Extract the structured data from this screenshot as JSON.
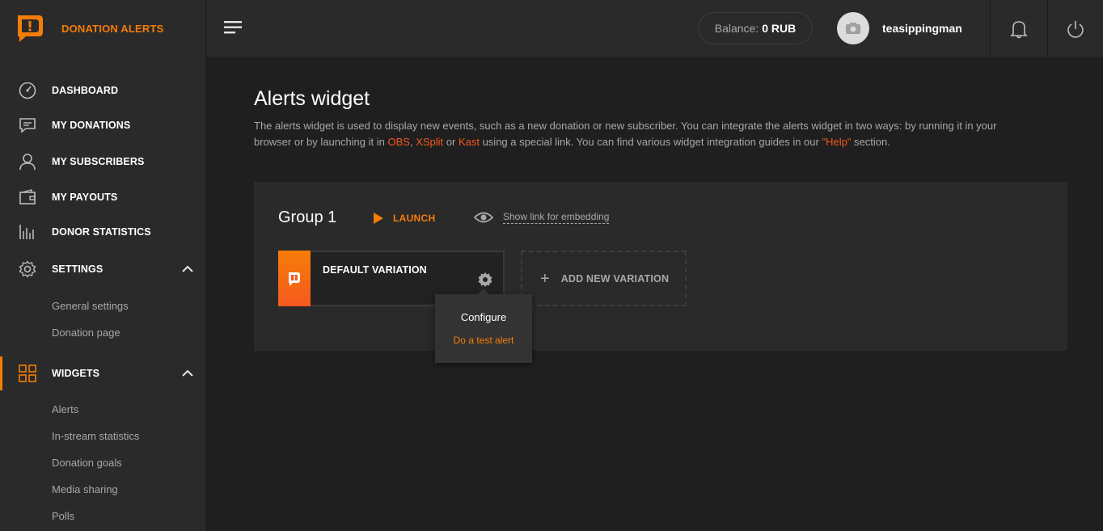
{
  "brand": {
    "name": "DONATION ALERTS",
    "accent": "#f57d07"
  },
  "topbar": {
    "balance_label": "Balance:",
    "balance_value": "0 RUB",
    "username": "teasippingman"
  },
  "sidebar": {
    "items": [
      {
        "label": "DASHBOARD",
        "icon": "dashboard-icon"
      },
      {
        "label": "MY DONATIONS",
        "icon": "chat-icon"
      },
      {
        "label": "MY SUBSCRIBERS",
        "icon": "user-icon"
      },
      {
        "label": "MY PAYOUTS",
        "icon": "wallet-icon"
      },
      {
        "label": "DONOR STATISTICS",
        "icon": "bar-chart-icon"
      },
      {
        "label": "SETTINGS",
        "icon": "gear-icon"
      },
      {
        "label": "WIDGETS",
        "icon": "grid-icon"
      }
    ],
    "settings_sub": [
      "General settings",
      "Donation page"
    ],
    "widgets_sub": [
      "Alerts",
      "In-stream statistics",
      "Donation goals",
      "Media sharing",
      "Polls"
    ]
  },
  "main": {
    "title": "Alerts widget",
    "desc_part1": "The alerts widget is used to display new events, such as a new donation or new subscriber. You can integrate the alerts widget in two ways: by running it in your browser or by launching it in ",
    "link_obs": "OBS",
    "sep1": ", ",
    "link_xsplit": "XSplit",
    "sep2": " or ",
    "link_kast": "Kast",
    "desc_part2": " using a special link. You can find various widget integration guides in our ",
    "link_help": "\"Help\"",
    "desc_part3": " section.",
    "group": {
      "title": "Group 1",
      "launch_label": "LAUNCH",
      "embed_label": "Show link for embedding",
      "variation_name": "DEFAULT VARIATION",
      "add_variation_label": "ADD NEW VARIATION"
    },
    "dropdown": {
      "configure": "Configure",
      "test_alert": "Do a test alert"
    }
  }
}
